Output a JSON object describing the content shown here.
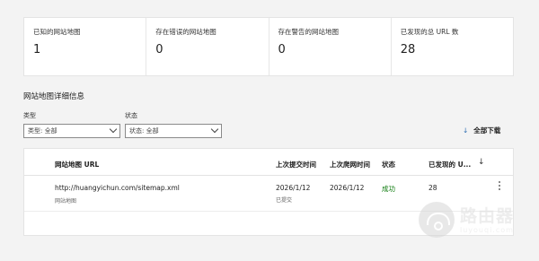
{
  "summary": [
    {
      "label": "已知的网站地图",
      "value": "1"
    },
    {
      "label": "存在错误的网站地图",
      "value": "0"
    },
    {
      "label": "存在警告的网站地图",
      "value": "0"
    },
    {
      "label": "已发现的总 URL 数",
      "value": "28"
    }
  ],
  "details": {
    "title": "网站地图详细信息",
    "filters": {
      "type_label": "类型",
      "type_value": "类型: 全部",
      "status_label": "状态",
      "status_value": "状态: 全部"
    },
    "download_label": "全部下载",
    "download_icon": "download-arrow-icon"
  },
  "table": {
    "headers": [
      "网站地图 URL",
      "上次提交时间",
      "上次爬网时间",
      "状态",
      "已发现的 U..."
    ],
    "rows": [
      {
        "url": "http://huangyichun.com/sitemap.xml",
        "url_sub": "网站地图",
        "submitted": "2026/1/12",
        "submitted_sub": "已提交",
        "crawled": "2026/1/12",
        "status": "成功",
        "discovered": "28"
      }
    ]
  },
  "watermark": {
    "text": "路由器",
    "url": "luyouqi.com"
  }
}
